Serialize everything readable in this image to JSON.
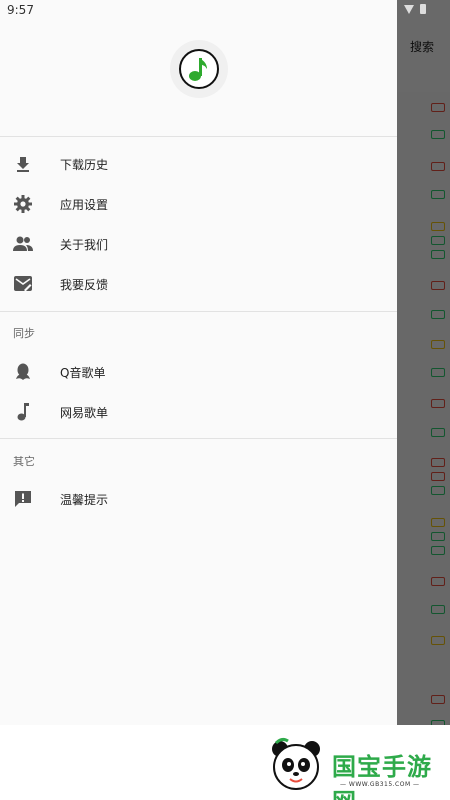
{
  "status_bar": {
    "time": "9:57"
  },
  "background_app": {
    "search_label": "搜索"
  },
  "drawer": {
    "menu": [
      {
        "label": "下载历史",
        "icon": "download-icon"
      },
      {
        "label": "应用设置",
        "icon": "gear-icon"
      },
      {
        "label": "关于我们",
        "icon": "people-icon"
      },
      {
        "label": "我要反馈",
        "icon": "feedback-icon"
      }
    ],
    "sync": {
      "header": "同步",
      "items": [
        {
          "label": "Q音歌单",
          "icon": "qq-penguin-icon"
        },
        {
          "label": "网易歌单",
          "icon": "music-note-icon"
        }
      ]
    },
    "other": {
      "header": "其它",
      "items": [
        {
          "label": "温馨提示",
          "icon": "alert-icon"
        }
      ]
    }
  },
  "watermark": {
    "brand": "国宝手游网",
    "url": "— WWW.GB315.COM —"
  },
  "colors": {
    "accent_green": "#2eaa4a",
    "scrim": "rgba(0,0,0,0.58)"
  }
}
